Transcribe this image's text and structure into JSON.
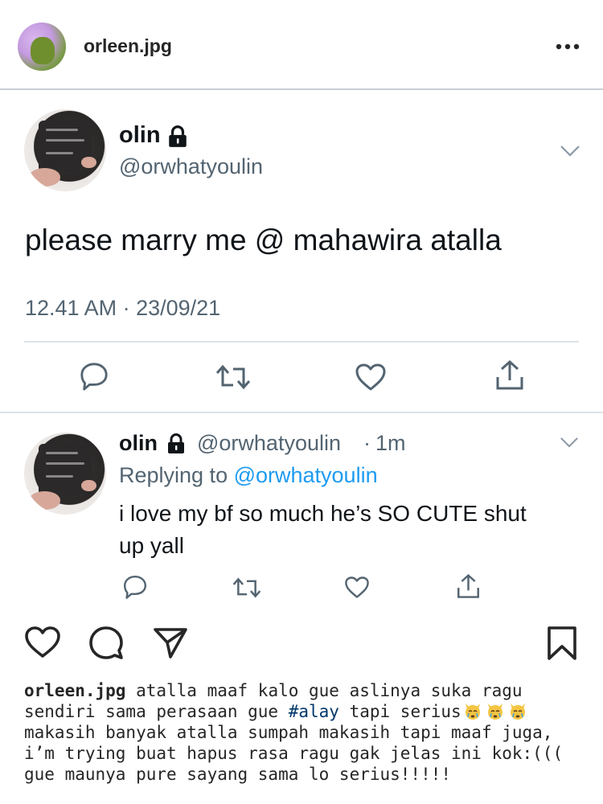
{
  "post": {
    "username": "orleen.jpg",
    "more_icon": "more-horizontal-icon"
  },
  "tweet": {
    "name": "olin",
    "handle": "@orwhatyoulin",
    "text": "please marry me @ mahawira atalla",
    "timestamp": "12.41 AM · 23/09/21"
  },
  "reply": {
    "name": "olin",
    "handle": "@orwhatyoulin",
    "time_sep": "·",
    "time": "1m",
    "replying_prefix": "Replying to ",
    "replying_to": "@orwhatyoulin",
    "text_line1": "i love my bf so much he’s SO CUTE shut",
    "text_line2": "up yall"
  },
  "caption": {
    "username": "orleen.jpg",
    "part1": " atalla maaf kalo gue aslinya suka ragu sendiri sama perasaan gue ",
    "hashtag": "#alay",
    "part2": " tapi serius",
    "part3": " makasih banyak atalla sumpah makasih tapi maaf juga, i’m trying buat hapus rasa ragu gak jelas ini kok:((( gue maunya pure sayang sama lo serius!!!!!",
    "emoji_icon": "crying-cat-emoji"
  },
  "colors": {
    "link_blue": "#1d9bf0",
    "hashtag_blue": "#00376b",
    "gray_text": "#536471"
  }
}
